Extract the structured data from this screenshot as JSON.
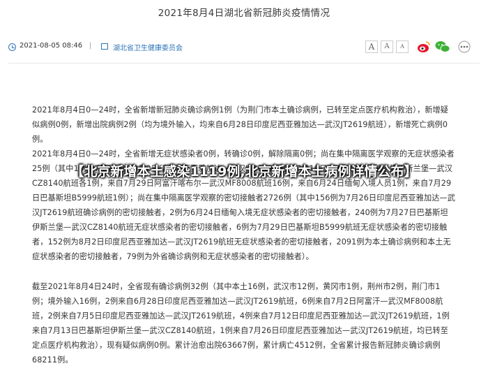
{
  "title": "2021年8月4日湖北省新冠肺炎疫情情况",
  "meta": {
    "date": "2021-08-05 08:46",
    "separator": "|",
    "source": "湖北省卫生健康委员会",
    "font_buttons": [
      "A",
      "A",
      "A"
    ],
    "share_icons": [
      "weibo-icon",
      "wechat-icon",
      "more-icon"
    ]
  },
  "paragraphs": [
    "2021年8月4日0—24时，全省新增新冠肺炎确诊病例1例（为荆门市本土确诊病例，已转至定点医疗机构救治），新增疑似病例0例，新增出院病例2例（均为境外输入，均来自6月28日印度尼西亚雅加达—武汉JT2619航班），新增死亡病例0例。",
    "2021年8月4日0—24时，全省新增无症状感染者0例，转确诊0例，解除隔离0例；尚在集中隔离医学观察的无症状感染者25例（其中1例为7月19日、8月2日印度尼西亚雅加达—武汉JT2619航班，7月19日、7月27日巴基斯坦伊斯兰堡—武汉CZ8140航班各1例，来自7月29日阿富汗喀布尔—武汉MF8008航班16例，来自6月24日缅甸入境人员1例，来自7月29日巴基斯坦B5999航班1例）；尚在集中隔离医学观察的密切接触者2726例（其中156例为7月26日印度尼西亚雅加达—武汉JT2619航班确诊病例的密切接触者，2例为6月24日缅甸入境无症状感染者的密切接触者，240例为7月27日巴基斯坦伊斯兰堡—武汉CZ8140航班无症状感染者的密切接触者，6例为7月29日巴基斯坦B5999航班无症状感染者的密切接触者，152例为8月2日印度尼西亚雅加达—武汉JT2619航班无症状感染者的密切接触者，2091例为本土确诊病例和本土无症状感染者的密切接触者，79例为外省确诊病例和无症状感染者的密切接触者）。",
    "截至2021年8月4日24时，全省现有确诊病例32例（其中本土16例，武汉市12例，黄冈市1例，荆州市2例，荆门市1例；境外输入16例，2例来自6月28日印度尼西亚雅加达—武汉JT2619航班，6例来自7月2日阿富汗—武汉MF8008航班，2例来自7月5日印度尼西亚雅加达—武汉JT2619航班，4例来自7月12日印度尼西亚雅加达—武汉JT2619航班，1例来自7月13日巴基斯坦伊斯兰堡—武汉CZ8140航班，1例来自7月26日印度尼西亚雅加达—武汉JT2619航班，均已转至定点医疗机构救治），现有疑似病例0例。累计治愈出院63667例，累计病亡4512例，全省累计报告新冠肺炎确诊病例68211例。"
  ],
  "overlay_caption": "【北京新增本土感染1119例,北京新增本土病例详情公布】"
}
